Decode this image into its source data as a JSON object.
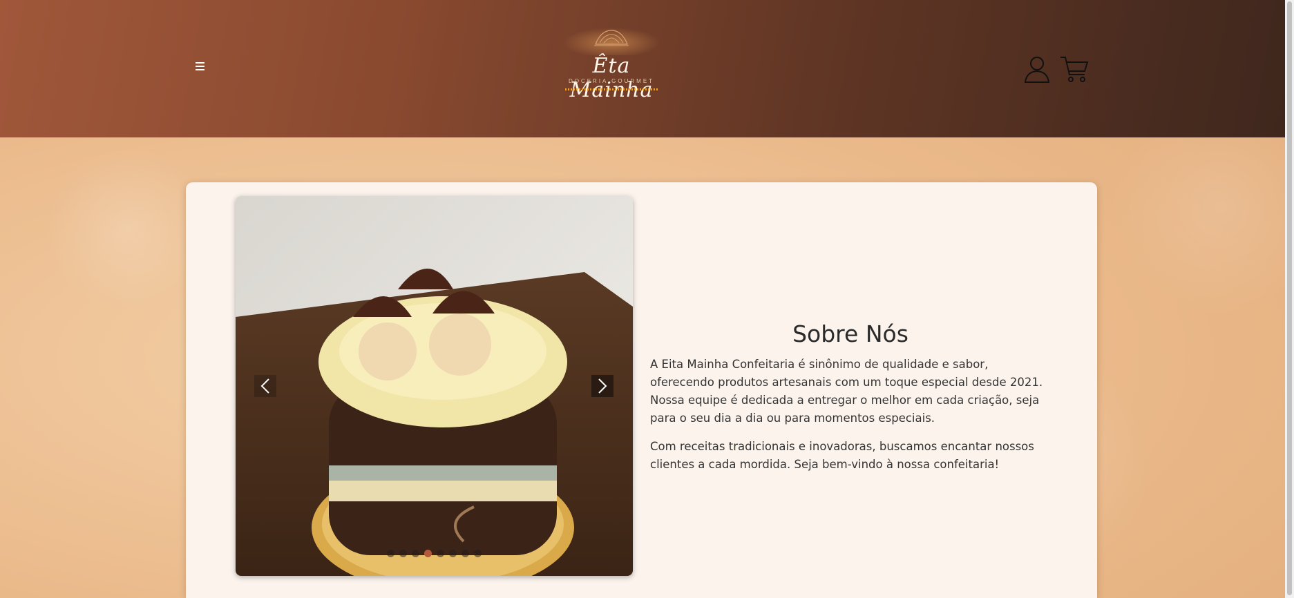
{
  "header": {
    "menu_icon": "menu-icon",
    "logo_title": "Êta Mainha",
    "logo_subtitle": "DOCERIA GOURMET",
    "user_icon": "user-icon",
    "cart_icon": "cart-icon"
  },
  "carousel": {
    "slide_count": 8,
    "active_index": 3,
    "prev_icon": "chevron-left-icon",
    "next_icon": "chevron-right-icon"
  },
  "about": {
    "title": "Sobre Nós",
    "paragraph_1": "A Eita Mainha Confeitaria é sinônimo de qualidade e sabor, oferecendo produtos artesanais com um toque especial desde 2021. Nossa equipe é dedicada a entregar o melhor em cada criação, seja para o seu dia a dia ou para momentos especiais.",
    "paragraph_2": "Com receitas tradicionais e inovadoras, buscamos encantar nossos clientes a cada mordida. Seja bem-vindo à nossa confeitaria!"
  },
  "colors": {
    "header_start": "#a0573a",
    "header_end": "#3f271d",
    "accent_dot": "#b5593b",
    "card_bg": "#fbf3ec"
  }
}
